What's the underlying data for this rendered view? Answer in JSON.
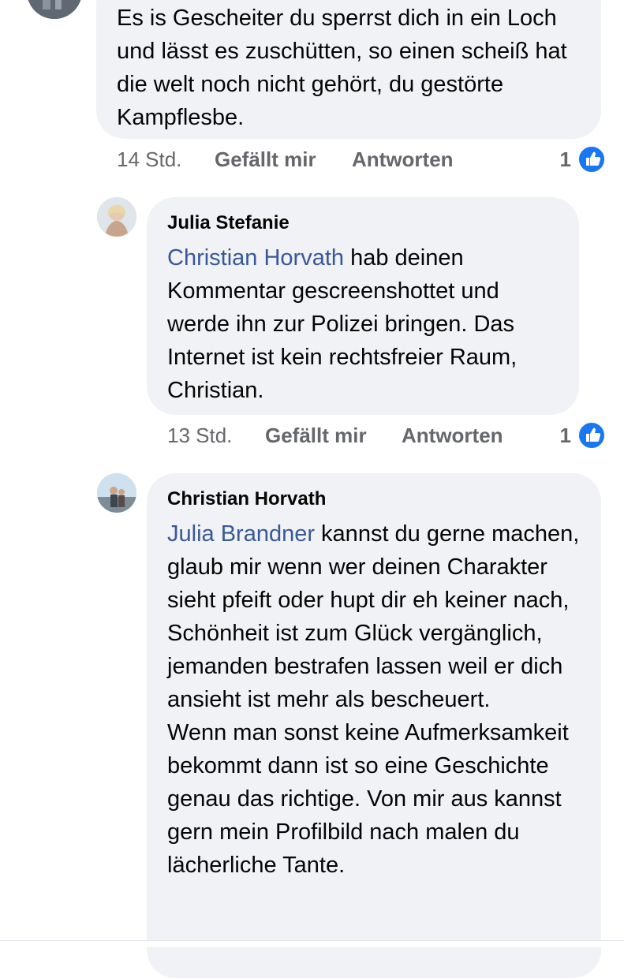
{
  "colors": {
    "bubble_bg": "#f0f2f5",
    "mention": "#385898",
    "meta_text": "#65676b",
    "like_blue": "#1877f2"
  },
  "comments": [
    {
      "author": "",
      "mention": "",
      "text": "Es is Gescheiter du sperrst dich in ein Loch und lässt es zuschütten, so einen scheiß hat die welt noch nicht gehört, du gestörte Kampflesbe.",
      "time": "14 Std.",
      "like_label": "Gefällt mir",
      "reply_label": "Antworten",
      "reaction_count": "1",
      "reaction_icon": "thumbs-up-icon"
    },
    {
      "author": "Julia Stefanie",
      "mention": "Christian Horvath",
      "text": " hab deinen Kommentar gescreenshottet und werde ihn zur Polizei bringen. Das Internet ist kein rechtsfreier Raum, Christian.",
      "time": "13 Std.",
      "like_label": "Gefällt mir",
      "reply_label": "Antworten",
      "reaction_count": "1",
      "reaction_icon": "thumbs-up-icon"
    },
    {
      "author": "Christian Horvath",
      "mention": "Julia Brandner",
      "text": " kannst du gerne machen, glaub mir wenn wer deinen Charakter sieht pfeift oder hupt dir eh keiner nach, Schönheit ist zum Glück vergänglich, jemanden bestrafen lassen weil er dich ansieht ist mehr als bescheuert.",
      "text2": "Wenn man sonst keine Aufmerksamkeit bekommt dann ist so eine Geschichte genau das richtige. Von mir aus kannst gern mein Profilbild nach malen du lächerliche Tante."
    }
  ]
}
